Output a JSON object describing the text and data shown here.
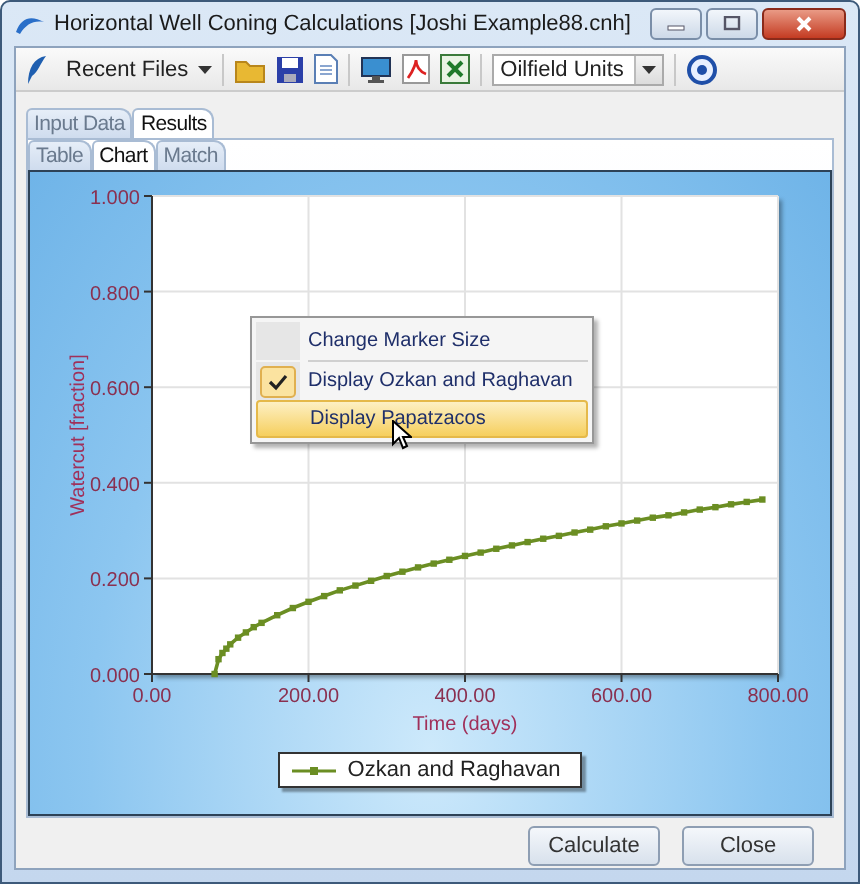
{
  "window": {
    "title": "Horizontal Well Coning Calculations [Joshi Example88.cnh]"
  },
  "toolbar": {
    "recent_files": "Recent Files",
    "units": "Oilfield Units"
  },
  "tabs": [
    {
      "label": "Input Data",
      "selected": false
    },
    {
      "label": "Results",
      "selected": true
    }
  ],
  "subtabs": [
    {
      "label": "Table",
      "selected": false
    },
    {
      "label": "Chart",
      "selected": true
    },
    {
      "label": "Match",
      "selected": false
    }
  ],
  "chart": {
    "chart_data": {
      "type": "line",
      "xlabel": "Time (days)",
      "ylabel": "Watercut [fraction]",
      "xlim": [
        0,
        800
      ],
      "ylim": [
        0,
        1
      ],
      "xticks": [
        {
          "value": 0,
          "label": "0.00"
        },
        {
          "value": 200,
          "label": "200.00"
        },
        {
          "value": 400,
          "label": "400.00"
        },
        {
          "value": 600,
          "label": "600.00"
        },
        {
          "value": 800,
          "label": "800.00"
        }
      ],
      "yticks": [
        {
          "value": 0,
          "label": "0.000"
        },
        {
          "value": 0.2,
          "label": "0.200"
        },
        {
          "value": 0.4,
          "label": "0.400"
        },
        {
          "value": 0.6,
          "label": "0.600"
        },
        {
          "value": 0.8,
          "label": "0.800"
        },
        {
          "value": 1,
          "label": "1.000"
        }
      ],
      "x": [
        80,
        85,
        90,
        95,
        100,
        110,
        120,
        130,
        140,
        160,
        180,
        200,
        220,
        240,
        260,
        280,
        300,
        320,
        340,
        360,
        380,
        400,
        420,
        440,
        460,
        480,
        500,
        520,
        540,
        560,
        580,
        600,
        620,
        640,
        660,
        680,
        700,
        720,
        740,
        760,
        780
      ],
      "grid": true,
      "series": [
        {
          "name": "Ozkan and Raghavan",
          "color": "#6b8e23",
          "marker": "square",
          "values": [
            0,
            0.031,
            0.044,
            0.053,
            0.062,
            0.076,
            0.087,
            0.098,
            0.107,
            0.123,
            0.138,
            0.151,
            0.163,
            0.175,
            0.185,
            0.195,
            0.205,
            0.214,
            0.223,
            0.231,
            0.239,
            0.247,
            0.254,
            0.262,
            0.269,
            0.276,
            0.283,
            0.289,
            0.296,
            0.302,
            0.309,
            0.315,
            0.321,
            0.327,
            0.332,
            0.338,
            0.344,
            0.349,
            0.355,
            0.36,
            0.365
          ]
        }
      ]
    },
    "context_menu": {
      "items": [
        {
          "kind": "item",
          "label": "Change Marker Size",
          "checked": false,
          "selected": false
        },
        {
          "kind": "separator"
        },
        {
          "kind": "item",
          "label": "Display Ozkan and Raghavan",
          "checked": true,
          "selected": false
        },
        {
          "kind": "item",
          "label": "Display Papatzacos",
          "checked": false,
          "selected": true
        }
      ]
    }
  },
  "buttons": [
    "Calculate",
    "Close"
  ]
}
